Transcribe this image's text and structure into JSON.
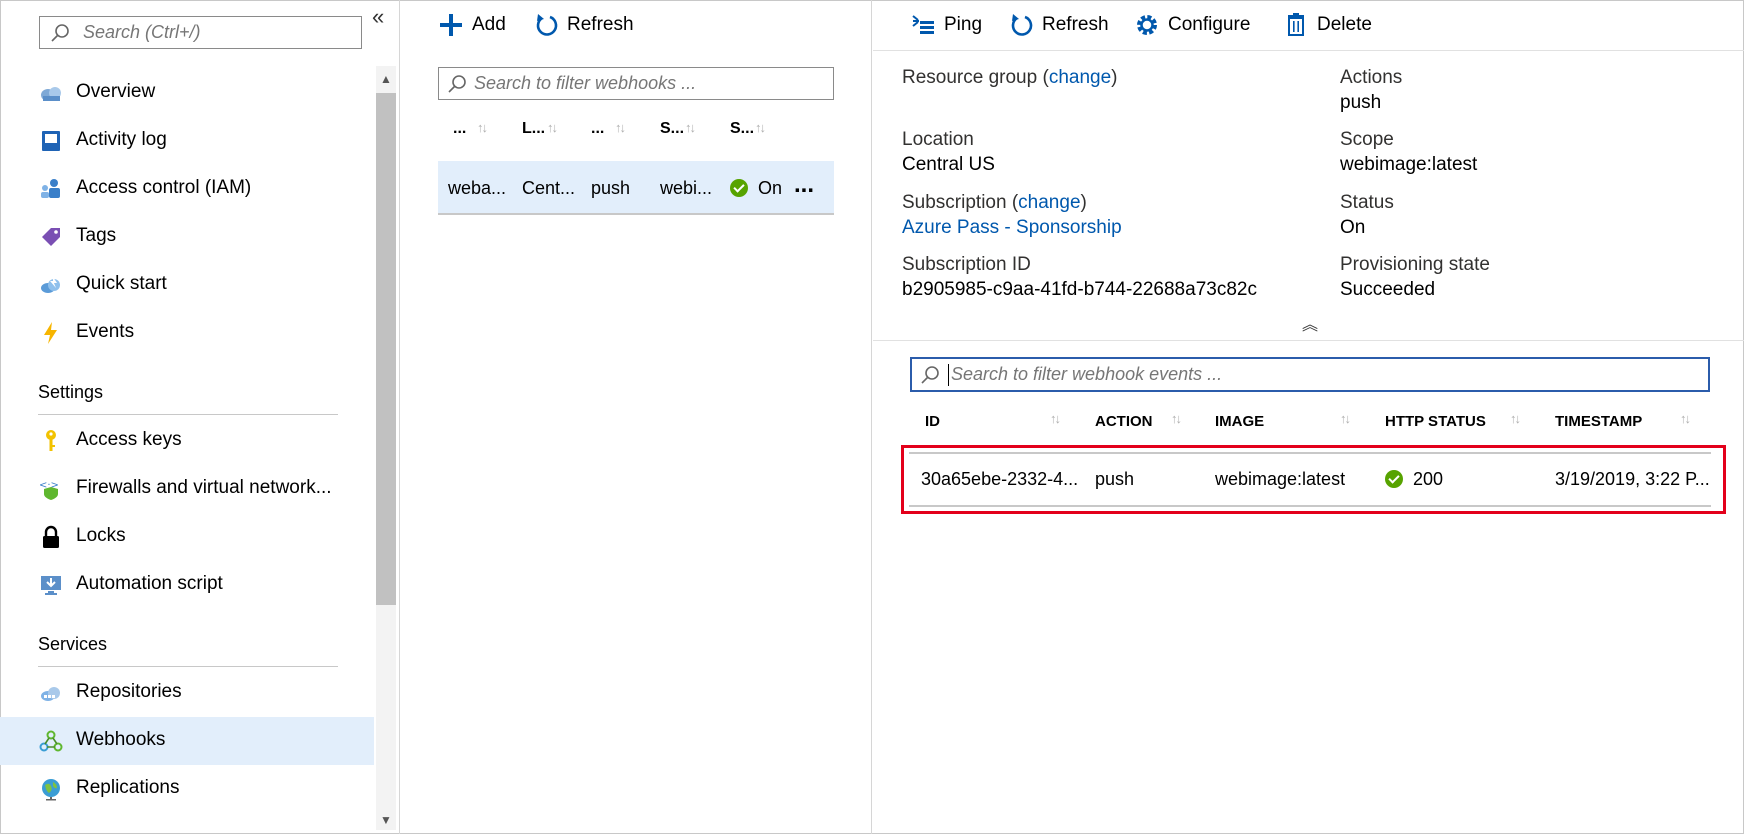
{
  "nav": {
    "search_placeholder": "Search (Ctrl+/)",
    "items_top": [
      {
        "label": "Overview",
        "icon": "cloud-overview-icon"
      },
      {
        "label": "Activity log",
        "icon": "activity-log-icon"
      },
      {
        "label": "Access control (IAM)",
        "icon": "people-icon"
      },
      {
        "label": "Tags",
        "icon": "tag-icon"
      },
      {
        "label": "Quick start",
        "icon": "cloud-quickstart-icon"
      },
      {
        "label": "Events",
        "icon": "lightning-icon"
      }
    ],
    "settings_heading": "Settings",
    "settings_items": [
      {
        "label": "Access keys",
        "icon": "key-icon"
      },
      {
        "label": "Firewalls and virtual network...",
        "icon": "network-shield-icon"
      },
      {
        "label": "Locks",
        "icon": "lock-icon"
      },
      {
        "label": "Automation script",
        "icon": "download-monitor-icon"
      }
    ],
    "services_heading": "Services",
    "services_items": [
      {
        "label": "Repositories",
        "icon": "repositories-icon"
      },
      {
        "label": "Webhooks",
        "icon": "webhook-icon",
        "active": true
      },
      {
        "label": "Replications",
        "icon": "globe-icon"
      }
    ]
  },
  "webhooks": {
    "add_label": "Add",
    "refresh_label": "Refresh",
    "filter_placeholder": "Search to filter webhooks ...",
    "columns": [
      "...",
      "L...",
      "...",
      "S...",
      "S..."
    ],
    "row": {
      "name": "weba...",
      "location": "Cent...",
      "actions": "push",
      "scope": "webi...",
      "status": "On",
      "more": "..."
    }
  },
  "details": {
    "toolbar": {
      "ping": "Ping",
      "refresh": "Refresh",
      "configure": "Configure",
      "delete": "Delete"
    },
    "resource_group_label": "Resource group",
    "change_label": "change",
    "location_label": "Location",
    "location_value": "Central US",
    "subscription_label": "Subscription",
    "subscription_value": "Azure Pass - Sponsorship",
    "subscription_id_label": "Subscription ID",
    "subscription_id_value": "b2905985-c9aa-41fd-b744-22688a73c82c",
    "actions_label": "Actions",
    "actions_value": "push",
    "scope_label": "Scope",
    "scope_value": "webimage:latest",
    "status_label": "Status",
    "status_value": "On",
    "prov_label": "Provisioning state",
    "prov_value": "Succeeded"
  },
  "events": {
    "filter_placeholder": "Search to filter webhook events ...",
    "columns": [
      "ID",
      "ACTION",
      "IMAGE",
      "HTTP STATUS",
      "TIMESTAMP"
    ],
    "row": {
      "id": "30a65ebe-2332-4...",
      "action": "push",
      "image": "webimage:latest",
      "http_status": "200",
      "timestamp": "3/19/2019, 3:22 P..."
    }
  },
  "colors": {
    "accent": "#0058ad",
    "active_bg": "#e2eefb",
    "success": "#57a300",
    "highlight": "#e3001b"
  }
}
